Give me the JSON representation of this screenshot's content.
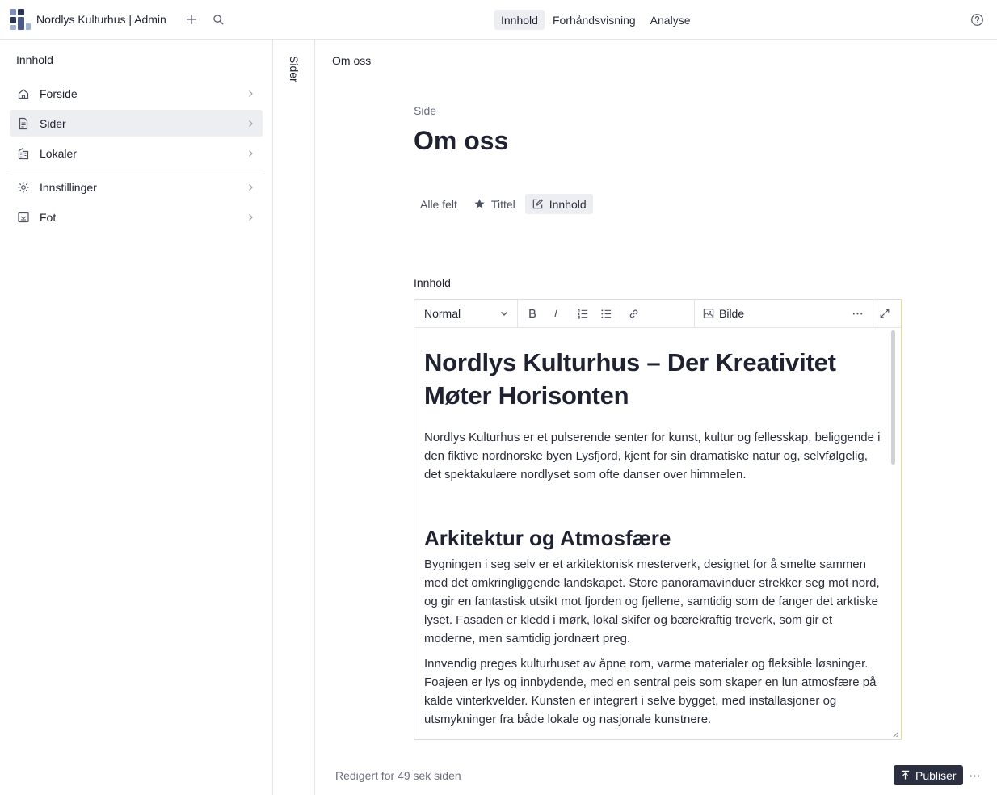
{
  "app": {
    "title": "Nordlys Kulturhus | Admin",
    "logo_icon": "studio-logo-icon",
    "accent": "#2b2f40"
  },
  "top_tabs": [
    {
      "label": "Innhold",
      "active": true
    },
    {
      "label": "Forhåndsvisning",
      "active": false
    },
    {
      "label": "Analyse",
      "active": false
    }
  ],
  "left_panel": {
    "heading": "Innhold",
    "items": [
      {
        "label": "Forside",
        "icon": "home-icon"
      },
      {
        "label": "Sider",
        "icon": "document-icon",
        "selected": true
      },
      {
        "label": "Lokaler",
        "icon": "building-icon"
      },
      {
        "label": "Innstillinger",
        "icon": "gear-icon"
      },
      {
        "label": "Fot",
        "icon": "footer-icon"
      }
    ]
  },
  "rail": {
    "label": "Sider"
  },
  "document": {
    "breadcrumb": "Om oss",
    "type": "Side",
    "title": "Om oss",
    "field_tabs": [
      {
        "label": "Alle felt",
        "icon": ""
      },
      {
        "label": "Tittel",
        "icon": "star-icon"
      },
      {
        "label": "Innhold",
        "icon": "edit-icon",
        "active": true
      }
    ],
    "field_label": "Innhold"
  },
  "editor": {
    "style_value": "Normal",
    "image_label": "Bilde",
    "content": {
      "h1": "Nordlys Kulturhus – Der Kreativitet Møter Horisonten",
      "p1": "Nordlys Kulturhus er et pulserende senter for kunst, kultur og fellesskap, beliggende i den fiktive nordnorske byen Lysfjord, kjent for sin dramatiske natur og, selvfølgelig, det spektakulære nordlyset som ofte danser over himmelen.",
      "h2": "Arkitektur og Atmosfære",
      "p2": "Bygningen i seg selv er et arkitektonisk mesterverk, designet for å smelte sammen med det omkringliggende landskapet. Store panoramavinduer strekker seg mot nord, og gir en fantastisk utsikt mot fjorden og fjellene, samtidig som de fanger det arktiske lyset. Fasaden er kledd i mørk, lokal skifer og bærekraftig treverk, som gir et moderne, men samtidig jordnært preg.",
      "p3": "Innvendig preges kulturhuset av åpne rom, varme materialer og fleksible løsninger. Foajeen er lys og innbydende, med en sentral peis som skaper en lun atmosfære på kalde vinterkvelder. Kunsten er integrert i selve bygget, med installasjoner og utsmykninger fra både lokale og nasjonale kunstnere."
    }
  },
  "footer": {
    "status": "Redigert for 49 sek siden",
    "publish_label": "Publiser"
  }
}
